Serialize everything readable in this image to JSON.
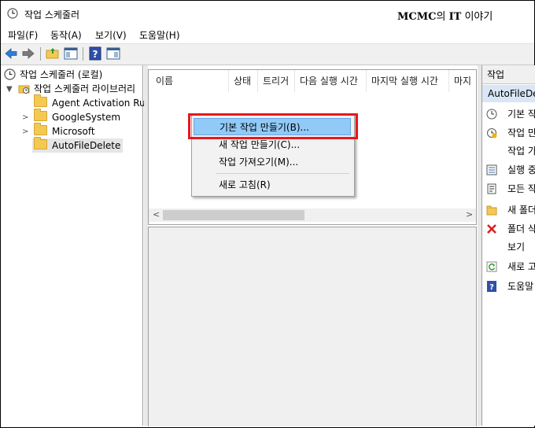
{
  "window": {
    "title": "작업 스케줄러"
  },
  "watermark": {
    "brand": "MCMC",
    "mid": "의 ",
    "it": "IT",
    "suffix": " 이야기"
  },
  "menubar": [
    "파일(F)",
    "동작(A)",
    "보기(V)",
    "도움말(H)"
  ],
  "tree": {
    "root": "작업 스케줄러 (로컬)",
    "library": "작업 스케줄러 라이브러리",
    "children": [
      "Agent Activation Run",
      "GoogleSystem",
      "Microsoft",
      "AutoFileDelete"
    ],
    "selected": "AutoFileDelete"
  },
  "list": {
    "columns": [
      "이름",
      "상태",
      "트리거",
      "다음 실행 시간",
      "마지막 실행 시간",
      "마지"
    ]
  },
  "context_menu": {
    "items": [
      "기본 작업 만들기(B)...",
      "새 작업 만들기(C)...",
      "작업 가져오기(M)...",
      "새로 고침(R)"
    ],
    "highlighted": "기본 작업 만들기(B)..."
  },
  "actions": {
    "header": "작업",
    "subheader": "AutoFileDelete",
    "items": [
      {
        "label": "기본 작업 만들기...",
        "icon": "clock-icon"
      },
      {
        "label": "작업 만들기...",
        "icon": "task-new-icon"
      },
      {
        "label": "작업 가져오기...",
        "icon": "none"
      },
      {
        "label": "실행 중인 모든 작업 표시",
        "icon": "list-icon"
      },
      {
        "label": "모든 작업 기록 사용",
        "icon": "history-icon"
      },
      {
        "label": "새 폴더...",
        "icon": "folder-icon"
      },
      {
        "label": "폴더 삭제",
        "icon": "delete-icon"
      },
      {
        "label": "보기",
        "icon": "none"
      },
      {
        "label": "새로 고침",
        "icon": "refresh-icon"
      },
      {
        "label": "도움말",
        "icon": "help-icon"
      }
    ]
  },
  "colors": {
    "highlight": "#91c9f7",
    "red_box": "#e8171f",
    "folder": "#f3c953"
  }
}
